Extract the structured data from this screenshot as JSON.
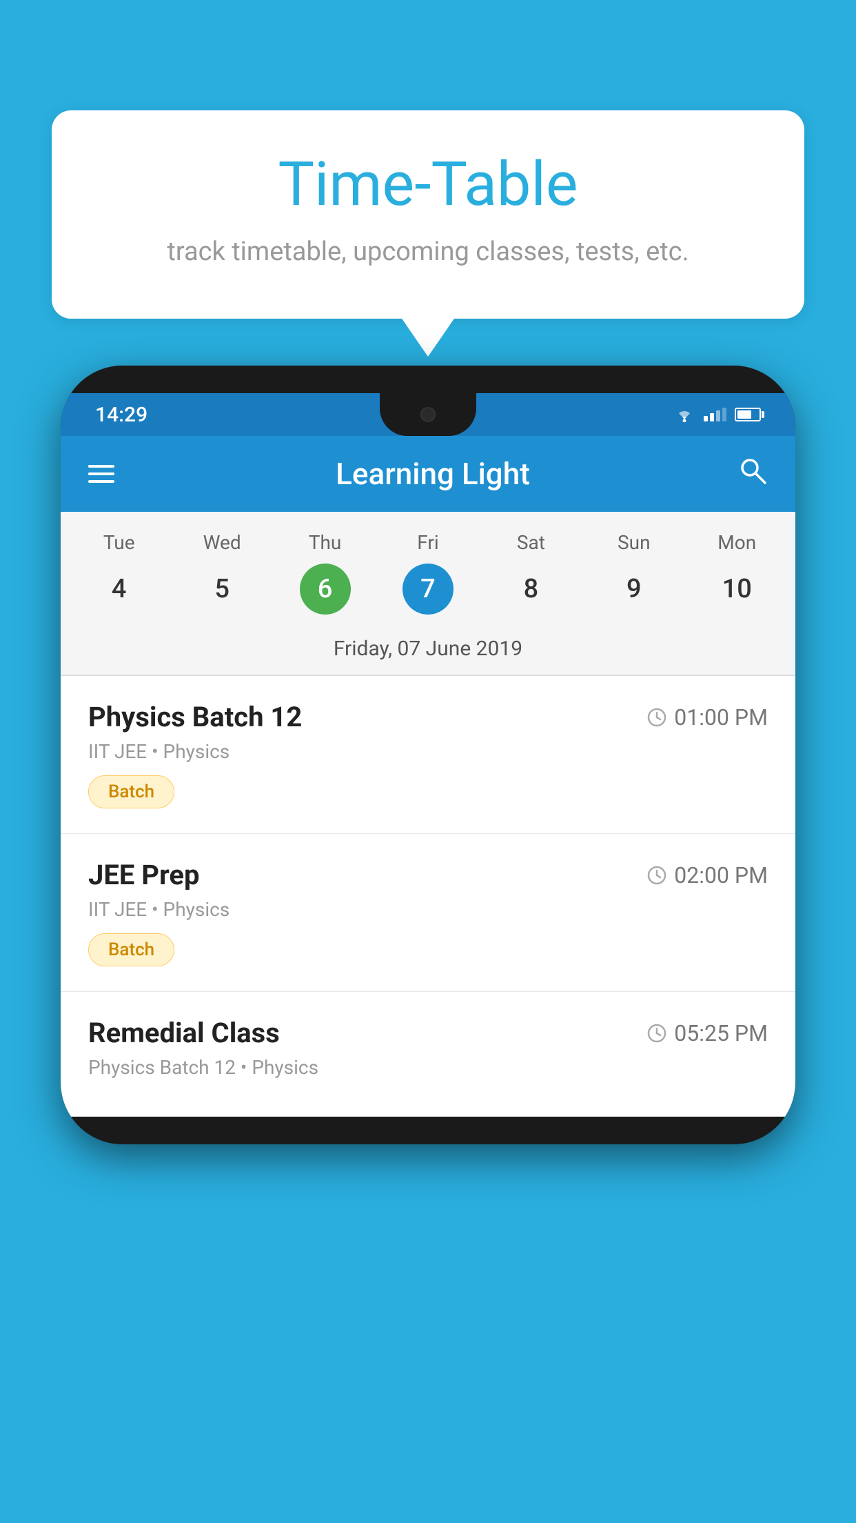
{
  "page": {
    "background_color": "#29AEDE"
  },
  "speech_bubble": {
    "title": "Time-Table",
    "subtitle": "track timetable, upcoming classes, tests, etc."
  },
  "app_bar": {
    "title": "Learning Light",
    "search_label": "search"
  },
  "status_bar": {
    "time": "14:29"
  },
  "calendar": {
    "selected_date_label": "Friday, 07 June 2019",
    "days": [
      {
        "name": "Tue",
        "num": "4",
        "state": "normal"
      },
      {
        "name": "Wed",
        "num": "5",
        "state": "normal"
      },
      {
        "name": "Thu",
        "num": "6",
        "state": "today"
      },
      {
        "name": "Fri",
        "num": "7",
        "state": "selected"
      },
      {
        "name": "Sat",
        "num": "8",
        "state": "normal"
      },
      {
        "name": "Sun",
        "num": "9",
        "state": "normal"
      },
      {
        "name": "Mon",
        "num": "10",
        "state": "normal"
      }
    ]
  },
  "schedule": {
    "items": [
      {
        "title": "Physics Batch 12",
        "time": "01:00 PM",
        "meta": "IIT JEE • Physics",
        "tag": "Batch"
      },
      {
        "title": "JEE Prep",
        "time": "02:00 PM",
        "meta": "IIT JEE • Physics",
        "tag": "Batch"
      },
      {
        "title": "Remedial Class",
        "time": "05:25 PM",
        "meta": "Physics Batch 12 • Physics",
        "tag": ""
      }
    ]
  }
}
